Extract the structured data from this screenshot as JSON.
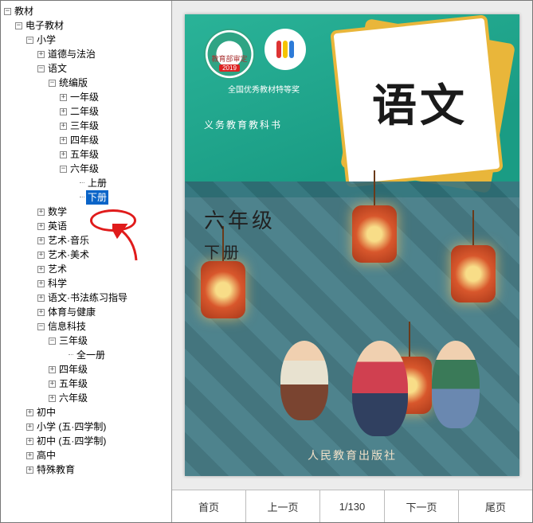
{
  "tree": {
    "root": "教材",
    "e_textbook": "电子教材",
    "primary": "小学",
    "morality": "道德与法治",
    "chinese": "语文",
    "unified_edition": "统编版",
    "grade1": "一年级",
    "grade2": "二年级",
    "grade3": "三年级",
    "grade4": "四年级",
    "grade5": "五年级",
    "grade6": "六年级",
    "vol_upper": "上册",
    "vol_lower": "下册",
    "math": "数学",
    "english": "英语",
    "art_music": "艺术·音乐",
    "art_fineart": "艺术·美术",
    "art": "艺术",
    "science": "科学",
    "calligraphy": "语文·书法练习指导",
    "pe_health": "体育与健康",
    "info_tech": "信息科技",
    "it_g3": "三年级",
    "it_g3_all": "全一册",
    "it_g4": "四年级",
    "it_g5": "五年级",
    "it_g6": "六年级",
    "junior": "初中",
    "primary54": "小学 (五·四学制)",
    "junior54": "初中 (五·四学制)",
    "senior": "高中",
    "special": "特殊教育"
  },
  "cover": {
    "approval": "教育部审定",
    "approval_year": "2019",
    "award_line": "全国优秀教材特等奖",
    "edu_series": "义务教育教科书",
    "subject_title": "语文",
    "grade_label": "六年级",
    "volume_label": "下册",
    "publisher": "人民教育出版社"
  },
  "toolbar": {
    "first": "首页",
    "prev": "上一页",
    "page_indicator": "1/130",
    "next": "下一页",
    "last": "尾页"
  }
}
